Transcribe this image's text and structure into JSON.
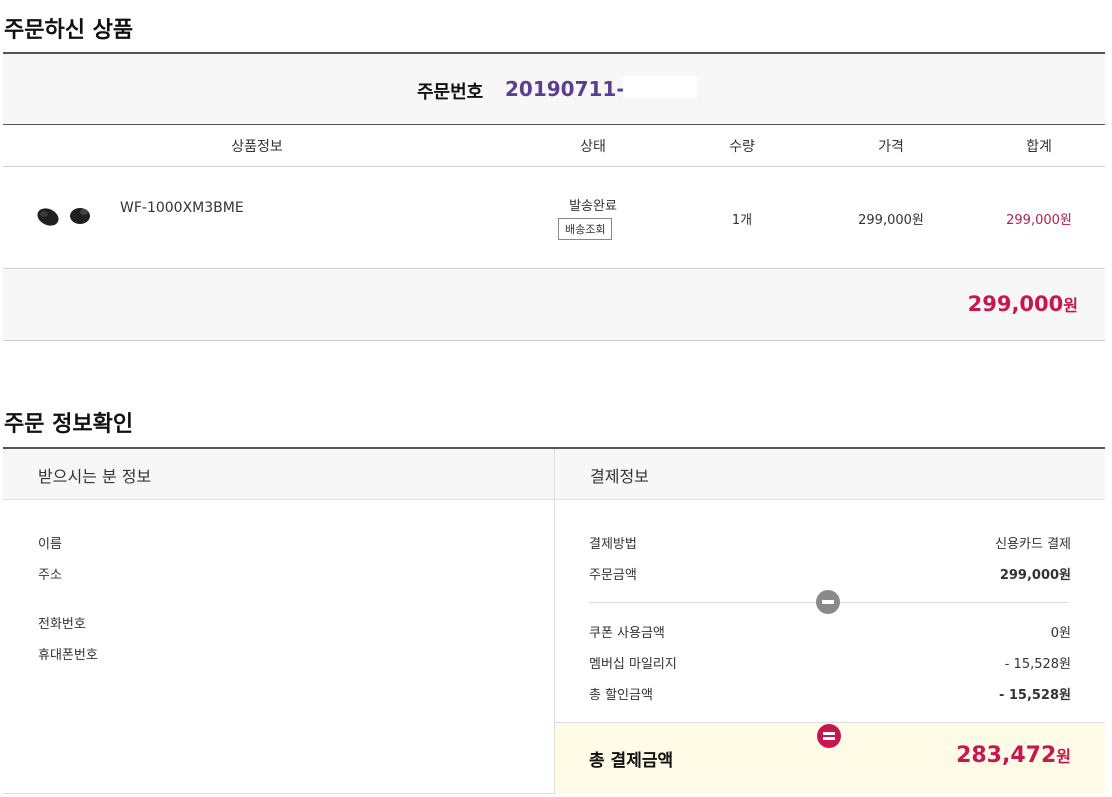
{
  "order_section": {
    "title": "주문하신 상품",
    "order_number_label": "주문번호",
    "order_number": "20190711-",
    "columns": [
      "상품정보",
      "상태",
      "수량",
      "가격",
      "합계"
    ],
    "product": {
      "name": "WF-1000XM3BME",
      "status": "발송완료",
      "track_button": "배송조회",
      "quantity": "1개",
      "price": "299,000원",
      "subtotal": "299,000원"
    },
    "total_amount": "299,000",
    "total_unit": "원"
  },
  "info_section": {
    "title": "주문 정보확인",
    "recipient_header": "받으시는 분 정보",
    "payment_header": "결제정보",
    "recipient_fields": {
      "name_label": "이름",
      "address_label": "주소",
      "phone_label": "전화번호",
      "mobile_label": "휴대폰번호"
    },
    "payment": {
      "method_label": "결제방법",
      "method_value": "신용카드 결제",
      "order_amount_label": "주문금액",
      "order_amount_value": "299,000원",
      "coupon_label": "쿠폰 사용금액",
      "coupon_value": "0원",
      "mileage_label": "멤버십 마일리지",
      "mileage_value": "- 15,528원",
      "discount_label": "총 할인금액",
      "discount_value": "- 15,528원",
      "final_label": "총 결제금액",
      "final_amount": "283,472",
      "final_unit": "원"
    }
  },
  "colors": {
    "accent": "#c8174f",
    "order_number": "#5b3d91",
    "minus_icon": "#8a8a8a",
    "equals_icon": "#c8174f"
  }
}
